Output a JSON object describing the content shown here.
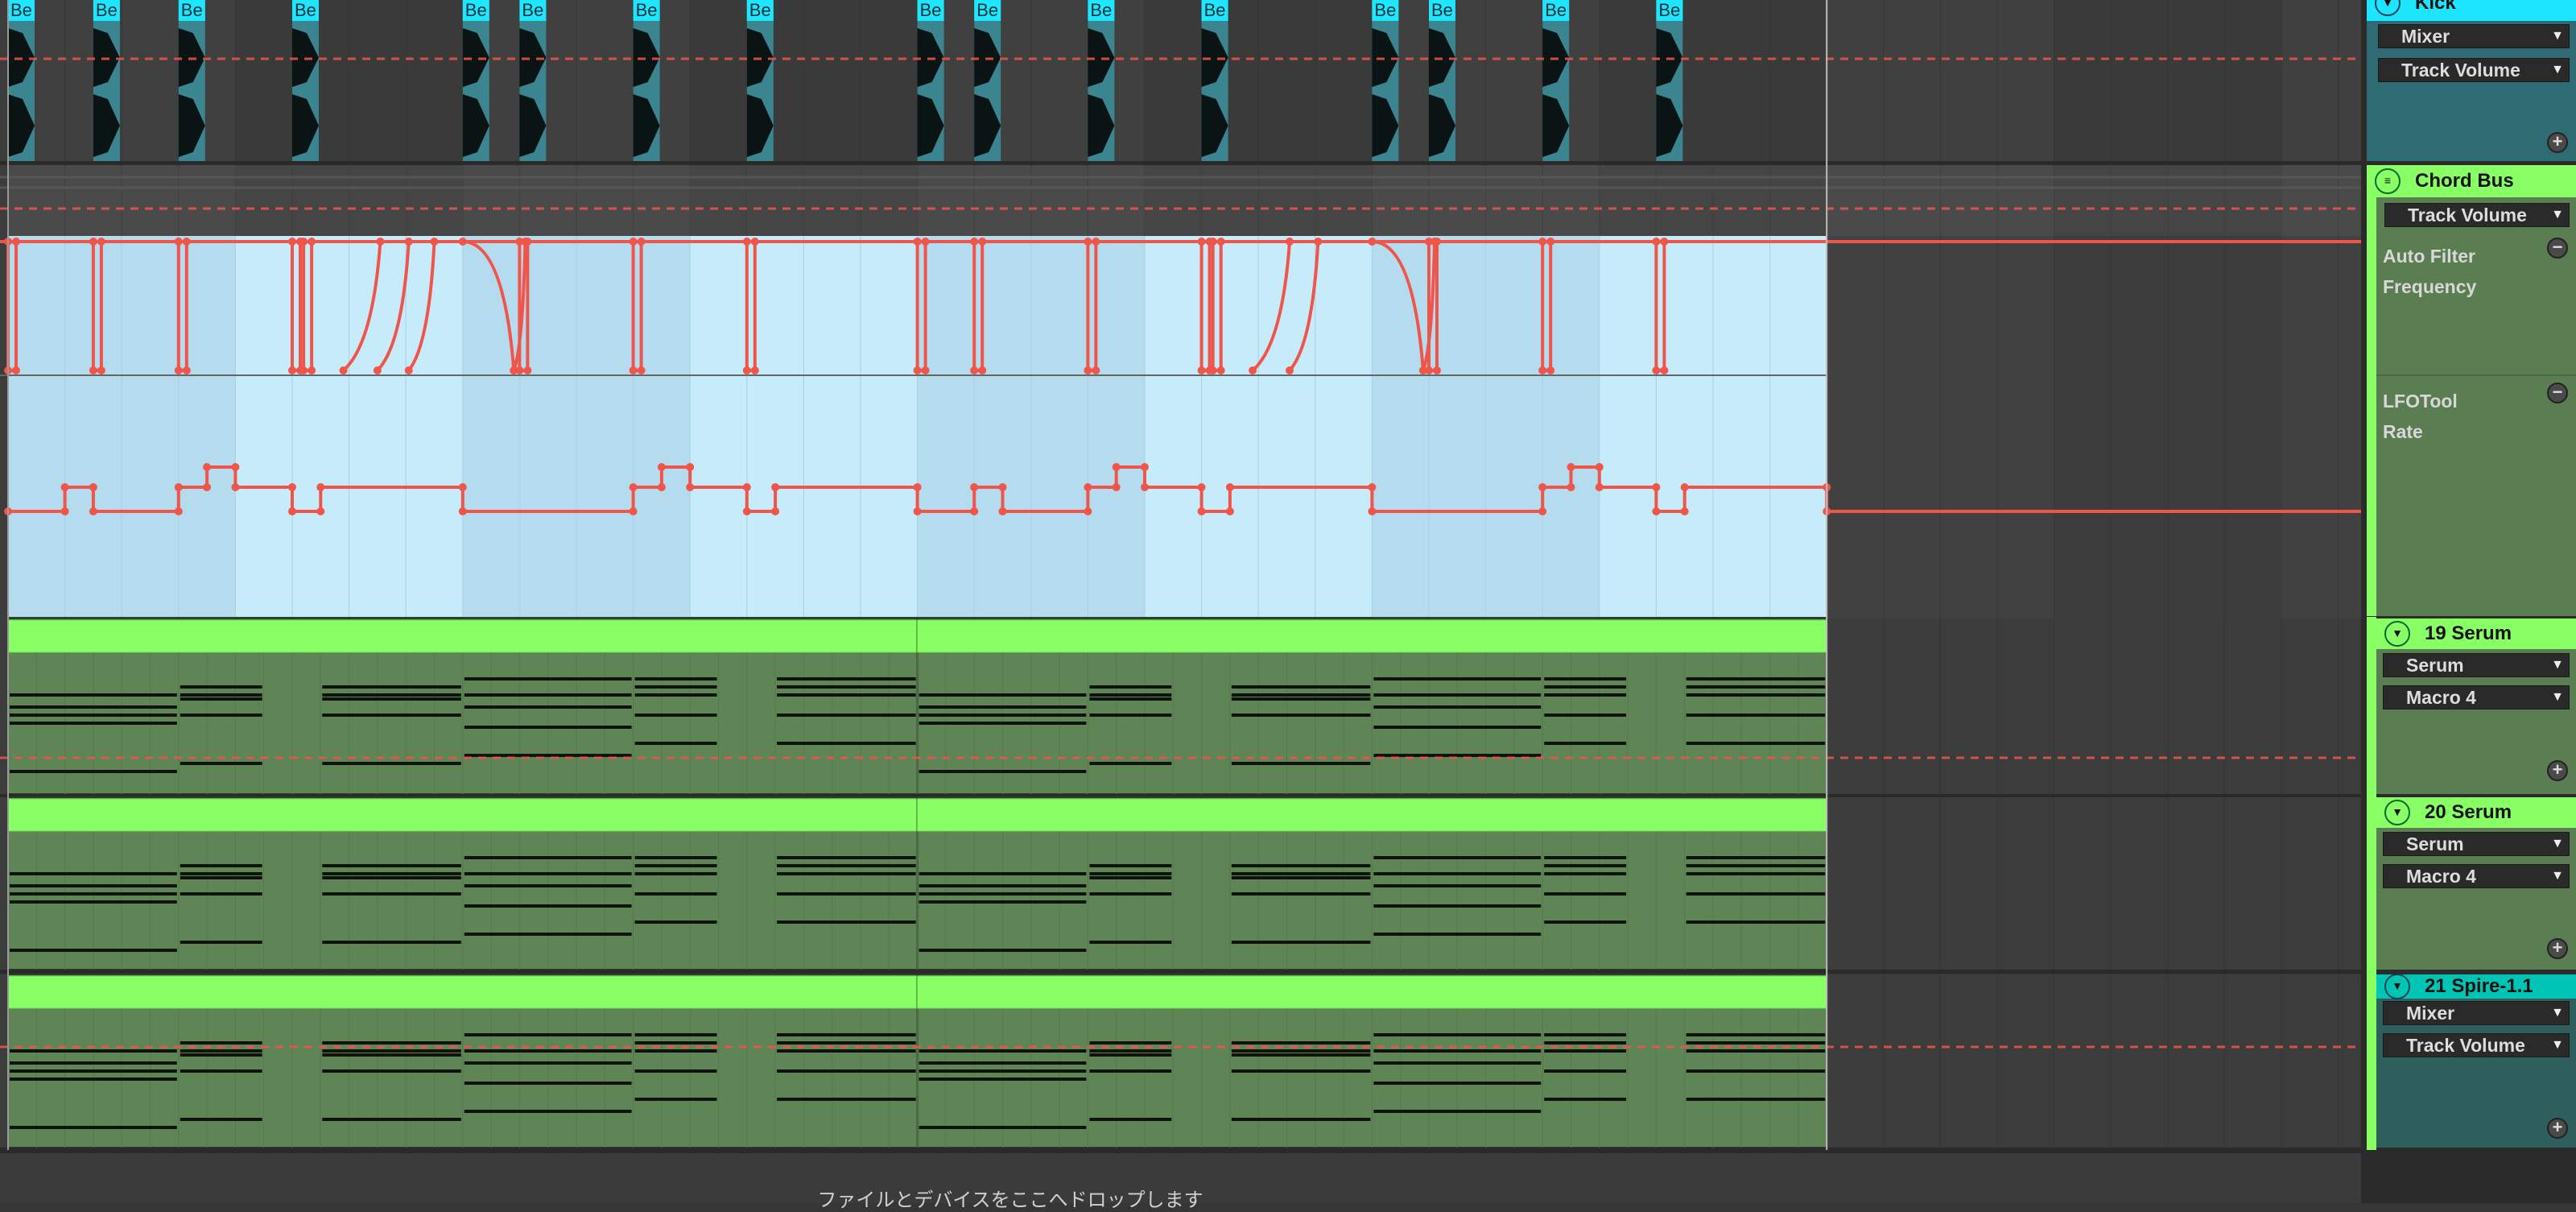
{
  "colors": {
    "automation": "#f0554a",
    "kick_header": "#1ee6ff",
    "kick_body": "#3b8590",
    "midi_header": "#87ff65",
    "midi_body": "#5f8455",
    "lane_blue": "#c6ebfb",
    "lane_blue_dark": "#b5dcee",
    "spire_header": "#00c4b4"
  },
  "timeline": {
    "total_steps": 64,
    "bar_steps": 32
  },
  "kick": {
    "clip_label": "Be",
    "clip_steps": [
      0,
      3,
      6,
      10,
      16,
      18,
      22,
      26,
      32,
      34,
      38,
      42,
      48,
      50,
      54,
      58
    ]
  },
  "auto_filter": {
    "dips": [
      0,
      3,
      6,
      10,
      10.4,
      18,
      22,
      26,
      32,
      34,
      38,
      42,
      42.4,
      50,
      54,
      58
    ],
    "curves": [
      [
        11.8,
        0,
        13.1,
        1
      ],
      [
        13.0,
        0,
        14.1,
        1
      ],
      [
        14.1,
        0,
        15.0,
        1
      ],
      [
        16,
        1,
        17.8,
        0
      ],
      [
        17.8,
        0,
        18.2,
        1
      ],
      [
        43.8,
        0,
        45.1,
        1
      ],
      [
        45.1,
        0,
        46.1,
        1
      ],
      [
        48,
        1,
        49.8,
        0
      ],
      [
        49.8,
        0,
        50.2,
        1
      ]
    ]
  },
  "lfo_rate": {
    "points": [
      [
        0,
        0
      ],
      [
        2,
        0
      ],
      [
        2,
        1
      ],
      [
        3,
        1
      ],
      [
        3,
        0
      ],
      [
        6,
        0
      ],
      [
        6,
        1
      ],
      [
        7,
        1
      ],
      [
        7,
        2
      ],
      [
        8,
        2
      ],
      [
        8,
        1
      ],
      [
        10,
        1
      ],
      [
        10,
        0
      ],
      [
        11,
        0
      ],
      [
        11,
        1
      ],
      [
        16,
        1
      ],
      [
        16,
        0
      ],
      [
        22,
        0
      ],
      [
        22,
        1
      ],
      [
        23,
        1
      ],
      [
        23,
        2
      ],
      [
        24,
        2
      ],
      [
        24,
        1
      ],
      [
        26,
        1
      ],
      [
        26,
        0
      ],
      [
        27,
        0
      ],
      [
        27,
        1
      ],
      [
        32,
        1
      ],
      [
        32,
        0
      ],
      [
        34,
        0
      ],
      [
        34,
        1
      ],
      [
        35,
        1
      ],
      [
        35,
        0
      ],
      [
        38,
        0
      ],
      [
        38,
        1
      ],
      [
        39,
        1
      ],
      [
        39,
        2
      ],
      [
        40,
        2
      ],
      [
        40,
        1
      ],
      [
        42,
        1
      ],
      [
        42,
        0
      ],
      [
        43,
        0
      ],
      [
        43,
        1
      ],
      [
        48,
        1
      ],
      [
        48,
        0
      ],
      [
        54,
        0
      ],
      [
        54,
        1
      ],
      [
        55,
        1
      ],
      [
        55,
        2
      ],
      [
        56,
        2
      ],
      [
        56,
        1
      ],
      [
        58,
        1
      ],
      [
        58,
        0
      ],
      [
        59,
        0
      ],
      [
        59,
        1
      ],
      [
        64,
        1
      ],
      [
        64,
        0
      ]
    ]
  },
  "midi_notes": [
    [
      0,
      6,
      5
    ],
    [
      0,
      6,
      8
    ],
    [
      0,
      6,
      10
    ],
    [
      0,
      6,
      12
    ],
    [
      0,
      6,
      24
    ],
    [
      6,
      3,
      3
    ],
    [
      6,
      3,
      5
    ],
    [
      6,
      3,
      6
    ],
    [
      6,
      3,
      10
    ],
    [
      6,
      3,
      22
    ],
    [
      11,
      5,
      3
    ],
    [
      11,
      5,
      5
    ],
    [
      11,
      5,
      6
    ],
    [
      11,
      5,
      10
    ],
    [
      11,
      5,
      22
    ],
    [
      16,
      6,
      1
    ],
    [
      16,
      6,
      5
    ],
    [
      16,
      6,
      8
    ],
    [
      16,
      6,
      13
    ],
    [
      16,
      6,
      20
    ],
    [
      22,
      3,
      1
    ],
    [
      22,
      3,
      3
    ],
    [
      22,
      3,
      5
    ],
    [
      22,
      3,
      10
    ],
    [
      22,
      3,
      17
    ],
    [
      27,
      5,
      1
    ],
    [
      27,
      5,
      3
    ],
    [
      27,
      5,
      5
    ],
    [
      27,
      5,
      10
    ],
    [
      27,
      5,
      17
    ]
  ],
  "drop_hint": "ファイルとデバイスをここへドロップします",
  "panel": {
    "kick": {
      "name": "Kick",
      "device": "Mixer",
      "param": "Track Volume"
    },
    "chord_bus": {
      "name": "Chord Bus",
      "param": "Track Volume",
      "lanes": [
        {
          "device": "Auto Filter",
          "param": "Frequency"
        },
        {
          "device": "LFOTool",
          "param": "Rate"
        }
      ]
    },
    "serum19": {
      "name": "19 Serum",
      "device": "Serum",
      "param": "Macro 4"
    },
    "serum20": {
      "name": "20 Serum",
      "device": "Serum",
      "param": "Macro 4"
    },
    "spire21": {
      "name": "21 Spire-1.1",
      "device": "Mixer",
      "param": "Track Volume"
    }
  }
}
